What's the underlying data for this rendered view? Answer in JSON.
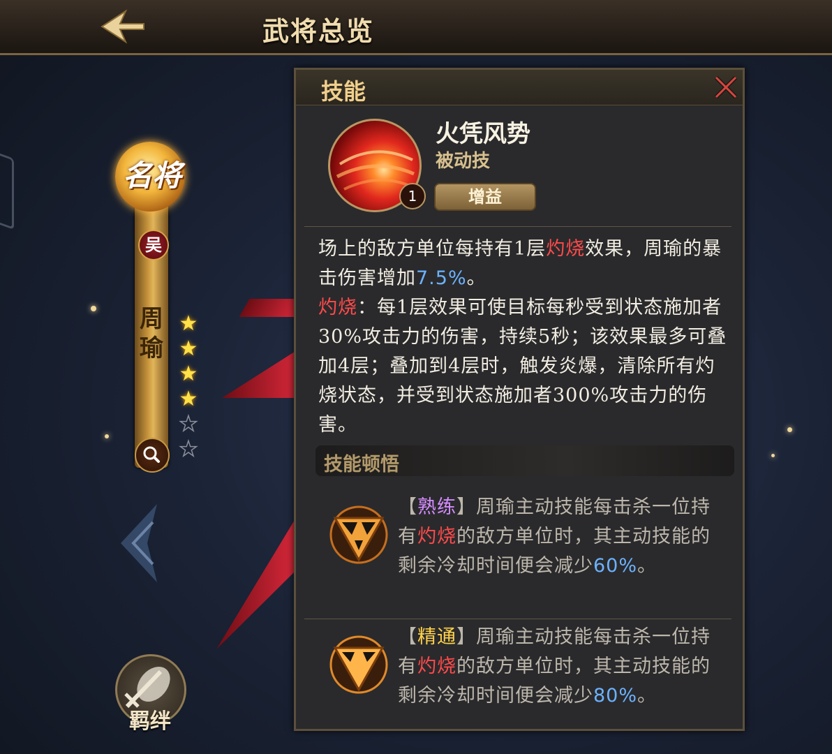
{
  "header": {
    "title": "武将总览"
  },
  "hero": {
    "rank_badge": "名将",
    "faction": "吴",
    "name_chars": [
      "周",
      "瑜"
    ],
    "stars_total": 6,
    "stars_filled": 4,
    "bond_label": "羁绊"
  },
  "panel": {
    "title": "技能",
    "skill": {
      "name": "火凭风势",
      "type": "被动技",
      "level": "1",
      "tag": "增益",
      "desc1": {
        "a": "场上的敌方单位每持有1层",
        "b": "灼烧",
        "c": "效果，周瑜的暴击伤害增加",
        "d": "7.5%",
        "e": "。"
      },
      "desc2": {
        "a": "灼烧",
        "b": "：每1层效果可使目标每秒受到状态施加者30%攻击力的伤害，持续5秒；该效果最多可叠加4层；叠加到4层时，触发炎爆，清除所有灼烧状态，并受到状态施加者300%攻击力的伤害。"
      }
    },
    "insight_title": "技能顿悟",
    "traits": [
      {
        "open": "【",
        "label": "熟练",
        "close": "】",
        "t1": "周瑜主动技能每击杀一位持有",
        "kw": "灼烧",
        "t2": "的敌方单位时，其主动技能的剩余冷却时间便会减少",
        "val": "60%",
        "end": "。"
      },
      {
        "open": "【",
        "label": "精通",
        "close": "】",
        "t1": "周瑜主动技能每击杀一位持有",
        "kw": "灼烧",
        "t2": "的敌方单位时，其主动技能的剩余冷却时间便会减少",
        "val": "80%",
        "end": "。"
      }
    ]
  },
  "colors": {
    "keyword_red": "#ff4a4a",
    "value_blue": "#6cb2ff",
    "trait1_label": "#d48bff",
    "trait2_label": "#ffd24a",
    "title_gold": "#f0cf8b"
  },
  "icons": {
    "back": "back-arrow-icon",
    "close": "close-icon",
    "zoom": "magnifier-icon",
    "prev": "chevron-left-icon",
    "bond": "crossed-swords-icon"
  }
}
